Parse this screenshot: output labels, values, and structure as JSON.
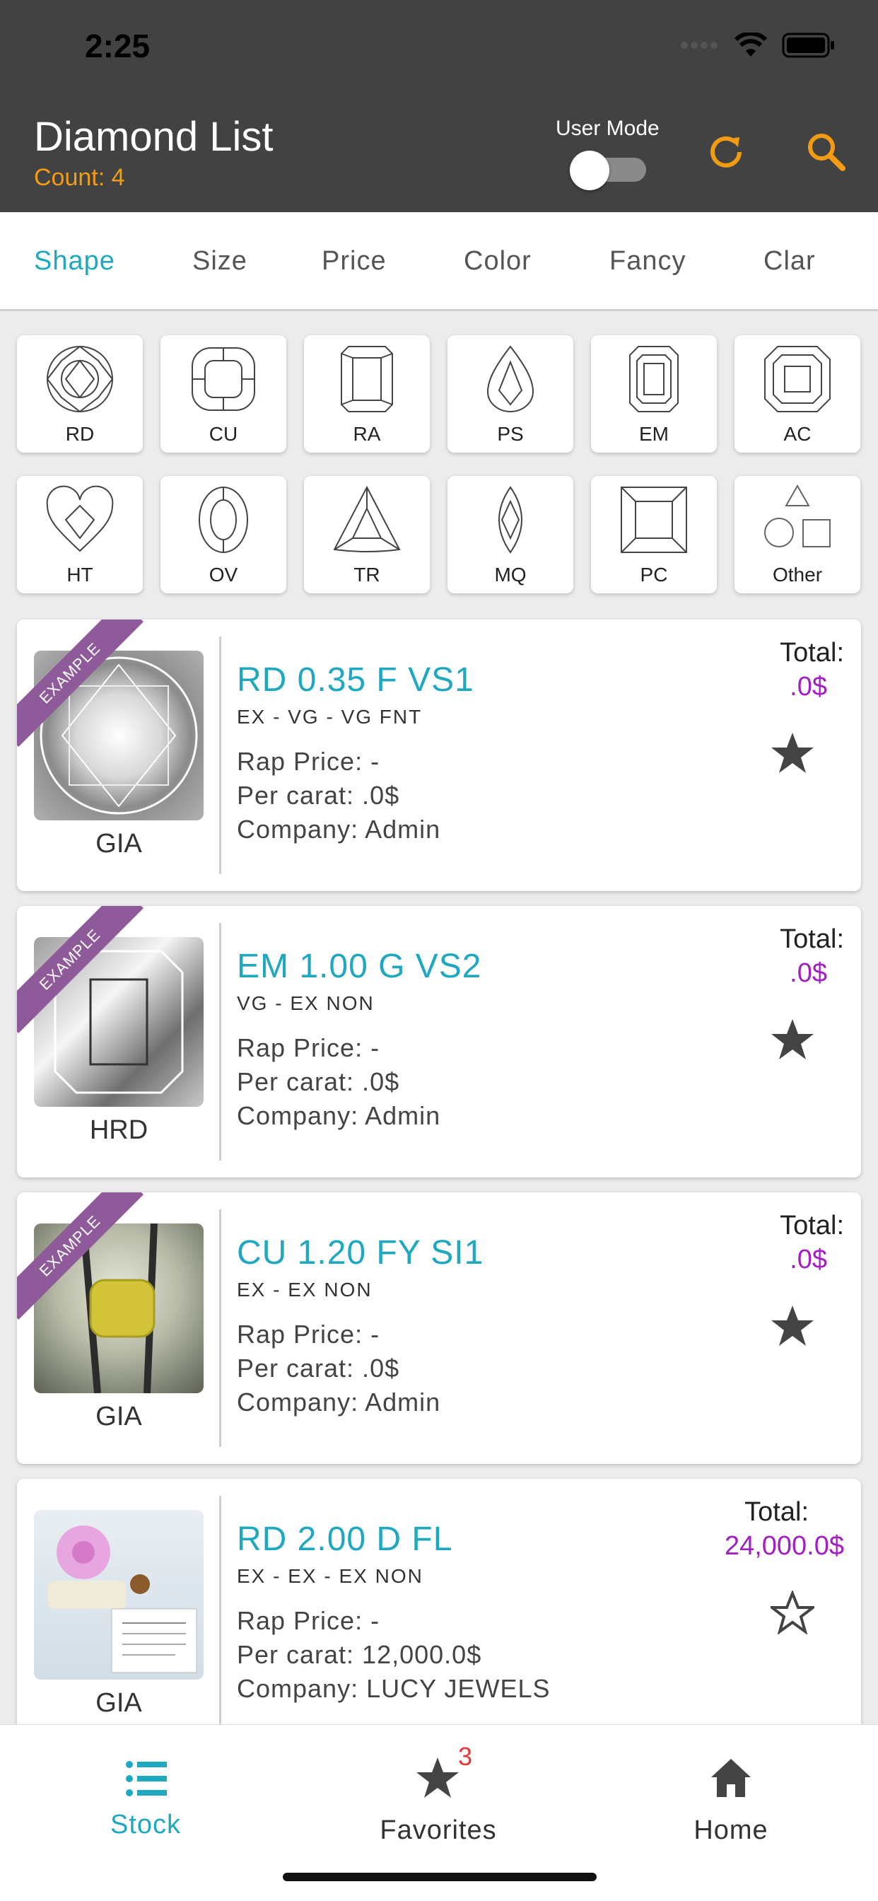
{
  "status_bar": {
    "time": "2:25"
  },
  "header": {
    "title": "Diamond List",
    "count": "Count: 4",
    "user_mode_label": "User Mode",
    "user_mode_on": false,
    "accent_color": "#f39c12"
  },
  "tabs": [
    {
      "label": "Shape",
      "active": true
    },
    {
      "label": "Size"
    },
    {
      "label": "Price"
    },
    {
      "label": "Color"
    },
    {
      "label": "Fancy"
    },
    {
      "label": "Clar"
    }
  ],
  "shapes": [
    {
      "code": "RD",
      "icon": "round-diamond-icon"
    },
    {
      "code": "CU",
      "icon": "cushion-diamond-icon"
    },
    {
      "code": "RA",
      "icon": "radiant-diamond-icon"
    },
    {
      "code": "PS",
      "icon": "pear-diamond-icon"
    },
    {
      "code": "EM",
      "icon": "emerald-diamond-icon"
    },
    {
      "code": "AC",
      "icon": "asscher-diamond-icon"
    },
    {
      "code": "HT",
      "icon": "heart-diamond-icon"
    },
    {
      "code": "OV",
      "icon": "oval-diamond-icon"
    },
    {
      "code": "TR",
      "icon": "trillion-diamond-icon"
    },
    {
      "code": "MQ",
      "icon": "marquise-diamond-icon"
    },
    {
      "code": "PC",
      "icon": "princess-diamond-icon"
    },
    {
      "code": "Other",
      "icon": "other-shapes-icon"
    }
  ],
  "diamonds": [
    {
      "title": "RD 0.35 F VS1",
      "sub": "EX - VG - VG  FNT",
      "rap": "Rap Price: -",
      "per_carat": "Per carat: .0$",
      "company": "Company: Admin",
      "lab": "GIA",
      "total_label": "Total:",
      "total": ".0$",
      "ribbon": "EXAMPLE",
      "favorite": true,
      "image": "round-diamond-photo"
    },
    {
      "title": "EM 1.00 G VS2",
      "sub": "VG - EX  NON",
      "rap": "Rap Price: -",
      "per_carat": "Per carat: .0$",
      "company": "Company: Admin",
      "lab": "HRD",
      "total_label": "Total:",
      "total": ".0$",
      "ribbon": "EXAMPLE",
      "favorite": true,
      "image": "emerald-diamond-photo"
    },
    {
      "title": "CU 1.20 FY SI1",
      "sub": "EX - EX  NON",
      "rap": "Rap Price: -",
      "per_carat": "Per carat: .0$",
      "company": "Company: Admin",
      "lab": "GIA",
      "total_label": "Total:",
      "total": ".0$",
      "ribbon": "EXAMPLE",
      "favorite": true,
      "image": "yellow-cushion-diamond-photo"
    },
    {
      "title": "RD 2.00 D FL",
      "sub": "EX - EX - EX  NON",
      "rap": "Rap Price: -",
      "per_carat": "Per carat: 12,000.0$",
      "company": "Company: LUCY JEWELS",
      "lab": "GIA",
      "total_label": "Total:",
      "total": "24,000.0$",
      "ribbon": "",
      "favorite": false,
      "image": "flower-gia-certificate-photo"
    }
  ],
  "bottom_nav": [
    {
      "label": "Stock",
      "icon": "list-icon",
      "active": true
    },
    {
      "label": "Favorites",
      "icon": "star-icon",
      "badge": "3"
    },
    {
      "label": "Home",
      "icon": "home-icon"
    }
  ]
}
